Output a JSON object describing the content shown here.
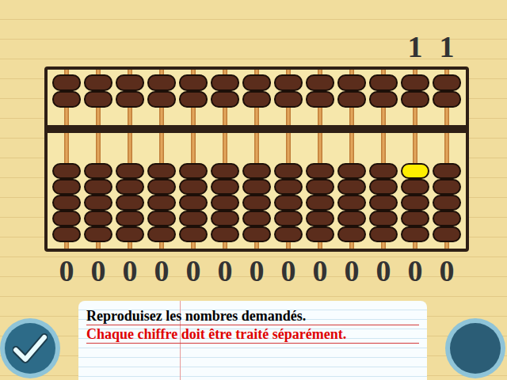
{
  "target": {
    "digits": [
      "1",
      "1"
    ]
  },
  "abacus": {
    "columns": [
      {
        "digit": "0",
        "highlighted_bead": false
      },
      {
        "digit": "0",
        "highlighted_bead": false
      },
      {
        "digit": "0",
        "highlighted_bead": false
      },
      {
        "digit": "0",
        "highlighted_bead": false
      },
      {
        "digit": "0",
        "highlighted_bead": false
      },
      {
        "digit": "0",
        "highlighted_bead": false
      },
      {
        "digit": "0",
        "highlighted_bead": false
      },
      {
        "digit": "0",
        "highlighted_bead": false
      },
      {
        "digit": "0",
        "highlighted_bead": false
      },
      {
        "digit": "0",
        "highlighted_bead": false
      },
      {
        "digit": "0",
        "highlighted_bead": false
      },
      {
        "digit": "0",
        "highlighted_bead": true
      },
      {
        "digit": "0",
        "highlighted_bead": false
      }
    ]
  },
  "instructions": [
    {
      "text": "Reproduisez les nombres demandés.",
      "color": "#000000"
    },
    {
      "text": "Chaque chiffre doit être traité séparément.",
      "color": "#e00000"
    }
  ]
}
